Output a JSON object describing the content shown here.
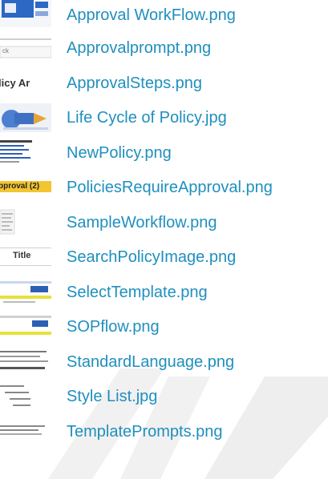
{
  "files": [
    {
      "name": "Approval WorkFlow.png",
      "thumb_text": ""
    },
    {
      "name": "Approvalprompt.png",
      "thumb_text": "ck"
    },
    {
      "name": "ApprovalSteps.png",
      "thumb_text": "licy Ar"
    },
    {
      "name": "Life Cycle of Policy.jpg",
      "thumb_text": ""
    },
    {
      "name": "NewPolicy.png",
      "thumb_text": ""
    },
    {
      "name": "PoliciesRequireApproval.png",
      "thumb_text": "pproval (2)"
    },
    {
      "name": "SampleWorkflow.png",
      "thumb_text": ""
    },
    {
      "name": "SearchPolicyImage.png",
      "thumb_text": "Title"
    },
    {
      "name": "SelectTemplate.png",
      "thumb_text": ""
    },
    {
      "name": "SOPflow.png",
      "thumb_text": ""
    },
    {
      "name": "StandardLanguage.png",
      "thumb_text": ""
    },
    {
      "name": "Style List.jpg",
      "thumb_text": ""
    },
    {
      "name": "TemplatePrompts.png",
      "thumb_text": ""
    }
  ],
  "colors": {
    "link": "#1f8fbe",
    "watermark": "#eeeeee"
  }
}
